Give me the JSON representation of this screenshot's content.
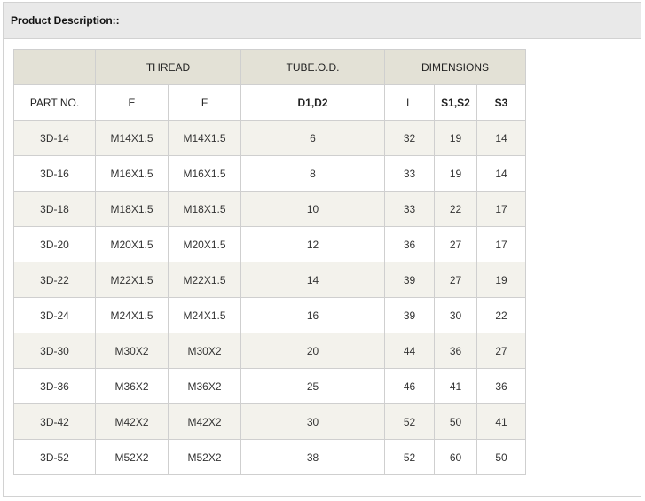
{
  "panel": {
    "title": "Product Description::"
  },
  "table": {
    "groups": {
      "part_blank": "",
      "thread": "THREAD",
      "tube_od": "TUBE.O.D.",
      "dimensions": "DIMENSIONS"
    },
    "columns": [
      "PART NO.",
      "E",
      "F",
      "D1,D2",
      "L",
      "S1,S2",
      "S3"
    ],
    "rows": [
      [
        "3D-14",
        "M14X1.5",
        "M14X1.5",
        "6",
        "32",
        "19",
        "14"
      ],
      [
        "3D-16",
        "M16X1.5",
        "M16X1.5",
        "8",
        "33",
        "19",
        "14"
      ],
      [
        "3D-18",
        "M18X1.5",
        "M18X1.5",
        "10",
        "33",
        "22",
        "17"
      ],
      [
        "3D-20",
        "M20X1.5",
        "M20X1.5",
        "12",
        "36",
        "27",
        "17"
      ],
      [
        "3D-22",
        "M22X1.5",
        "M22X1.5",
        "14",
        "39",
        "27",
        "19"
      ],
      [
        "3D-24",
        "M24X1.5",
        "M24X1.5",
        "16",
        "39",
        "30",
        "22"
      ],
      [
        "3D-30",
        "M30X2",
        "M30X2",
        "20",
        "44",
        "36",
        "27"
      ],
      [
        "3D-36",
        "M36X2",
        "M36X2",
        "25",
        "46",
        "41",
        "36"
      ],
      [
        "3D-42",
        "M42X2",
        "M42X2",
        "30",
        "52",
        "50",
        "41"
      ],
      [
        "3D-52",
        "M52X2",
        "M52X2",
        "38",
        "52",
        "60",
        "50"
      ]
    ]
  },
  "colors": {
    "header_band": "#e9e9e9",
    "group_header": "#e3e1d6",
    "row_alt": "#f3f2ec",
    "border": "#cfcfcf"
  }
}
